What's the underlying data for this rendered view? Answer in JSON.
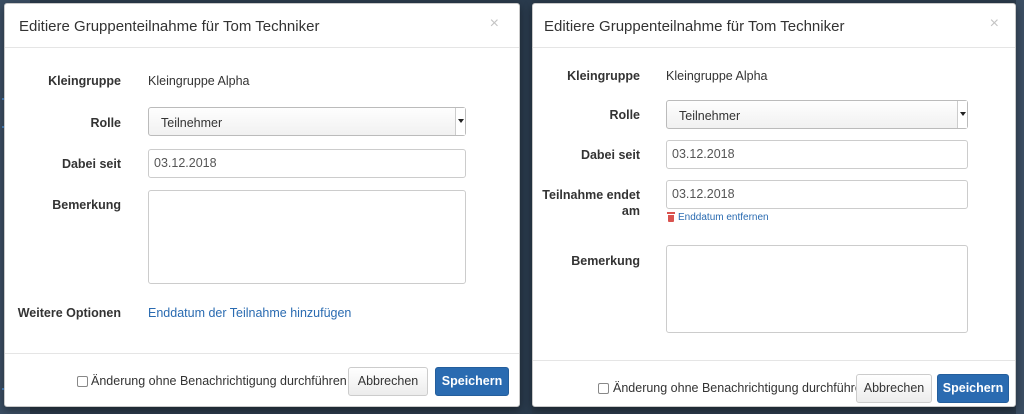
{
  "left_dialog": {
    "title": "Editiere Gruppenteilnahme für Tom Techniker",
    "close_glyph": "×",
    "kleingruppe_label": "Kleingruppe",
    "kleingruppe_value": "Kleingruppe Alpha",
    "rolle_label": "Rolle",
    "rolle_value": "Teilnehmer",
    "dabei_seit_label": "Dabei seit",
    "dabei_seit_value": "03.12.2018",
    "bemerkung_label": "Bemerkung",
    "bemerkung_value": "",
    "weitere_optionen_label": "Weitere Optionen",
    "add_enddate_link": "Enddatum der Teilnahme hinzufügen",
    "no_notification_label": "Änderung ohne Benachrichtigung durchführen",
    "no_notification_checked": false,
    "cancel_label": "Abbrechen",
    "save_label": "Speichern"
  },
  "right_dialog": {
    "title": "Editiere Gruppenteilnahme für Tom Techniker",
    "close_glyph": "×",
    "kleingruppe_label": "Kleingruppe",
    "kleingruppe_value": "Kleingruppe Alpha",
    "rolle_label": "Rolle",
    "rolle_value": "Teilnehmer",
    "dabei_seit_label": "Dabei seit",
    "dabei_seit_value": "03.12.2018",
    "teilnahme_endet_label_line1": "Teilnahme endet",
    "teilnahme_endet_label_line2": "am",
    "teilnahme_endet_value": "03.12.2018",
    "remove_enddate_link": "Enddatum entfernen",
    "bemerkung_label": "Bemerkung",
    "bemerkung_value": "",
    "no_notification_label": "Änderung ohne Benachrichtigung durchführen",
    "no_notification_checked": false,
    "cancel_label": "Abbrechen",
    "save_label": "Speichern"
  },
  "colors": {
    "primary": "#2a6bb1",
    "danger": "#d9534f",
    "backdrop": "#2b3a4a"
  },
  "icons": [
    "close-icon",
    "select-arrow-icon",
    "resize-grip-icon",
    "trash-icon",
    "checkbox-icon"
  ]
}
